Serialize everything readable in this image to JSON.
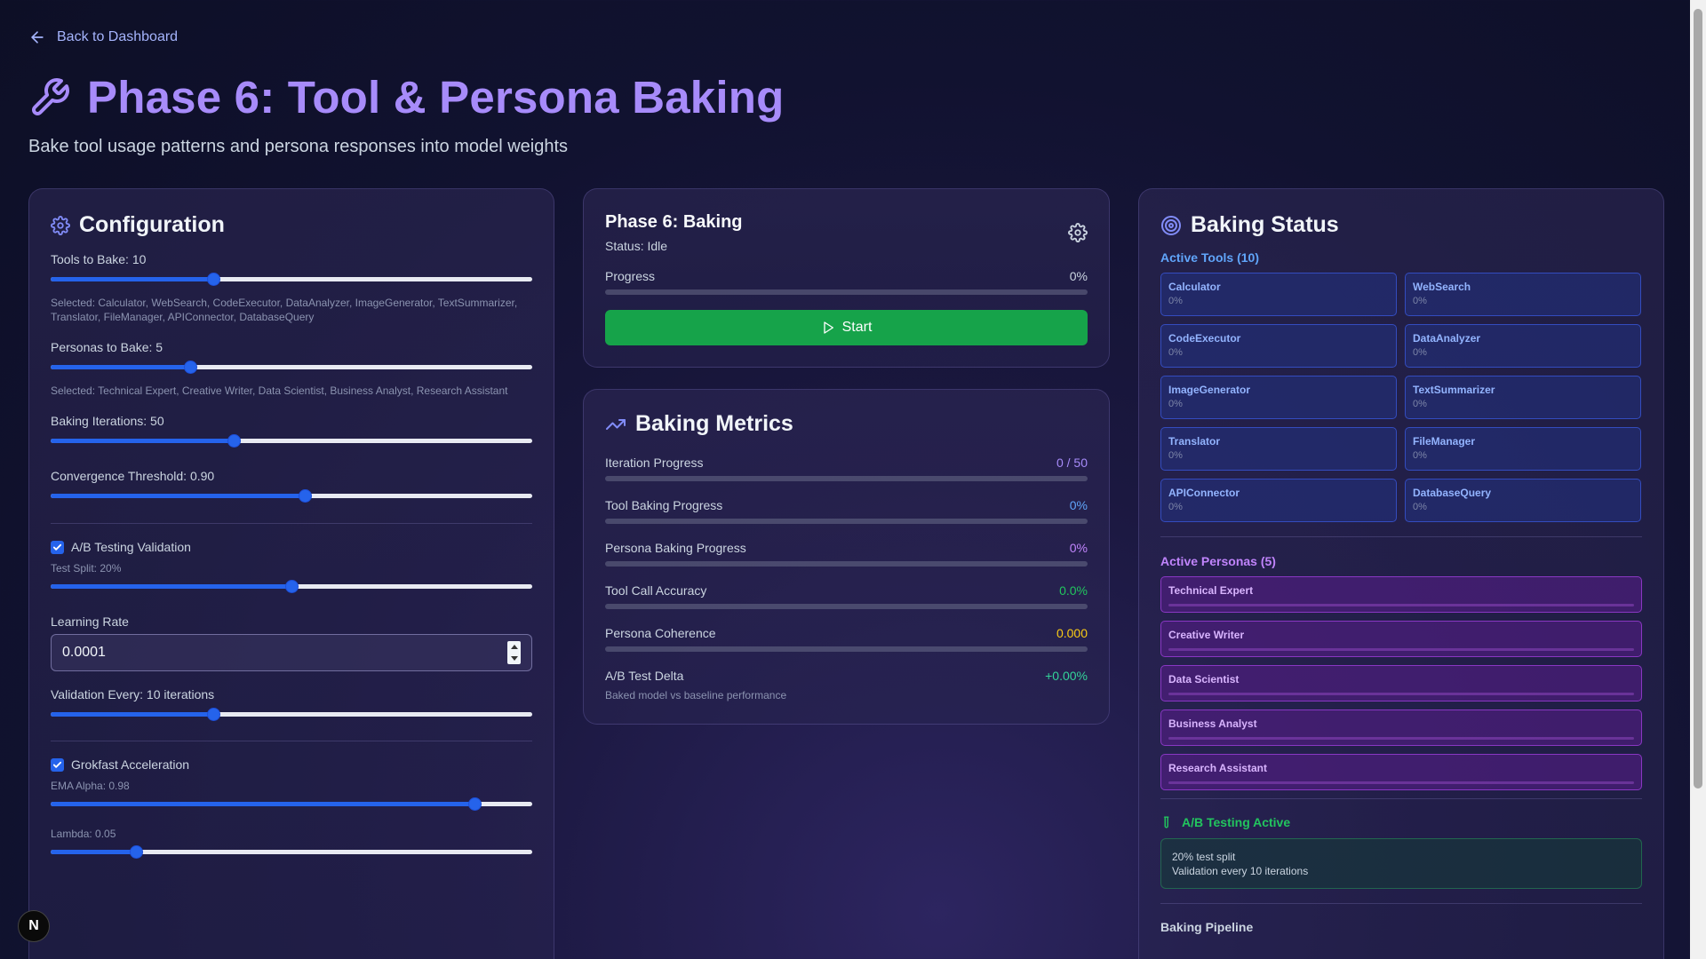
{
  "back_link": "Back to Dashboard",
  "title": "Phase 6: Tool & Persona Baking",
  "subtitle": "Bake tool usage patterns and persona responses into model weights",
  "config": {
    "heading": "Configuration",
    "tools_label": "Tools to Bake: 10",
    "tools_value": 10,
    "tools_selected": "Selected: Calculator, WebSearch, CodeExecutor, DataAnalyzer, ImageGenerator, TextSummarizer, Translator, FileManager, APIConnector, DatabaseQuery",
    "personas_label": "Personas to Bake: 5",
    "personas_value": 5,
    "personas_selected": "Selected: Technical Expert, Creative Writer, Data Scientist, Business Analyst, Research Assistant",
    "iterations_label": "Baking Iterations: 50",
    "iterations_value": 50,
    "convergence_label": "Convergence Threshold: 0.90",
    "convergence_value": 0.9,
    "ab_label": "A/B Testing Validation",
    "ab_checked": true,
    "test_split_label": "Test Split: 20%",
    "test_split_value": 0.2,
    "lr_label": "Learning Rate",
    "lr_value": "0.0001",
    "validation_label": "Validation Every: 10 iterations",
    "validation_value": 10,
    "grokfast_label": "Grokfast Acceleration",
    "grokfast_checked": true,
    "ema_label": "EMA Alpha: 0.98",
    "ema_value": 0.98,
    "lambda_label": "Lambda: 0.05",
    "lambda_value": 0.05
  },
  "phase": {
    "title": "Phase 6: Baking",
    "status": "Status: Idle",
    "progress_label": "Progress",
    "progress_value": "0%",
    "progress_fraction": 0,
    "start_label": "Start"
  },
  "metrics": {
    "heading": "Baking Metrics",
    "rows": [
      {
        "label": "Iteration Progress",
        "value": "0 / 50",
        "fraction": 0
      },
      {
        "label": "Tool Baking Progress",
        "value": "0%",
        "fraction": 0
      },
      {
        "label": "Persona Baking Progress",
        "value": "0%",
        "fraction": 0
      },
      {
        "label": "Tool Call Accuracy",
        "value": "0.0%",
        "fraction": 0
      },
      {
        "label": "Persona Coherence",
        "value": "0.000",
        "fraction": 0
      }
    ],
    "ab_delta_label": "A/B Test Delta",
    "ab_delta_value": "+0.00%",
    "ab_delta_note": "Baked model vs baseline performance"
  },
  "status": {
    "heading": "Baking Status",
    "tools_heading": "Active Tools (10)",
    "tools": [
      {
        "name": "Calculator",
        "pct": "0%"
      },
      {
        "name": "WebSearch",
        "pct": "0%"
      },
      {
        "name": "CodeExecutor",
        "pct": "0%"
      },
      {
        "name": "DataAnalyzer",
        "pct": "0%"
      },
      {
        "name": "ImageGenerator",
        "pct": "0%"
      },
      {
        "name": "TextSummarizer",
        "pct": "0%"
      },
      {
        "name": "Translator",
        "pct": "0%"
      },
      {
        "name": "FileManager",
        "pct": "0%"
      },
      {
        "name": "APIConnector",
        "pct": "0%"
      },
      {
        "name": "DatabaseQuery",
        "pct": "0%"
      }
    ],
    "personas_heading": "Active Personas (5)",
    "personas": [
      "Technical Expert",
      "Creative Writer",
      "Data Scientist",
      "Business Analyst",
      "Research Assistant"
    ],
    "ab_heading": "A/B Testing Active",
    "ab_line1": "20% test split",
    "ab_line2": "Validation every 10 iterations",
    "pipeline_heading": "Baking Pipeline"
  },
  "badge": "N",
  "colors": {
    "accent": "#a78bfa",
    "slider": "#2563eb",
    "start": "#16a34a",
    "tool_tile": "#3b5adc",
    "persona_tile": "#9b3cd2",
    "ab_green": "#22c55e"
  }
}
